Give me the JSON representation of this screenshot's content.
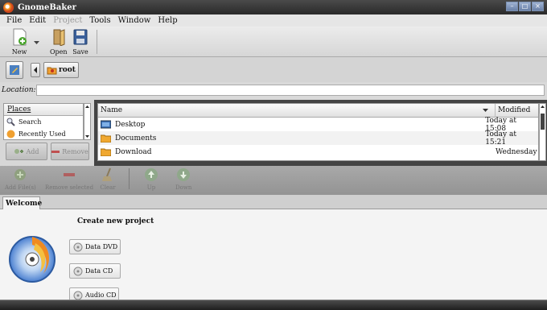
{
  "window": {
    "title": "GnomeBaker"
  },
  "menu": {
    "items": [
      "File",
      "Edit",
      "Project",
      "Tools",
      "Window",
      "Help"
    ]
  },
  "toolbar": {
    "new_label": "New",
    "open_label": "Open",
    "save_label": "Save"
  },
  "breadcrumb": {
    "root_label": "root"
  },
  "location": {
    "label": "Location:",
    "value": ""
  },
  "places": {
    "header": "Places",
    "items": [
      {
        "label": "Search",
        "icon": "search-icon"
      },
      {
        "label": "Recently Used",
        "icon": "recent-icon"
      }
    ],
    "add_label": "Add",
    "remove_label": "Remove"
  },
  "files": {
    "col_name": "Name",
    "col_modified": "Modified",
    "rows": [
      {
        "name": "Desktop",
        "modified": "Today at 15:08",
        "icon": "desktop-icon"
      },
      {
        "name": "Documents",
        "modified": "Today at 15:21",
        "icon": "folder-icon"
      },
      {
        "name": "Download",
        "modified": "Wednesday",
        "icon": "folder-icon"
      }
    ]
  },
  "compilation": {
    "add_files": "Add File(s)",
    "remove_selected": "Remove selected",
    "clear": "Clear",
    "up": "Up",
    "down": "Down"
  },
  "tabs": [
    {
      "label": "Welcome"
    }
  ],
  "welcome": {
    "heading": "Create new project",
    "buttons": [
      "Data DVD",
      "Data CD",
      "Audio CD"
    ]
  },
  "colors": {
    "titlebar": "#2a2a2a",
    "accent": "#f0a030",
    "disabled": "#9a9a9a"
  }
}
